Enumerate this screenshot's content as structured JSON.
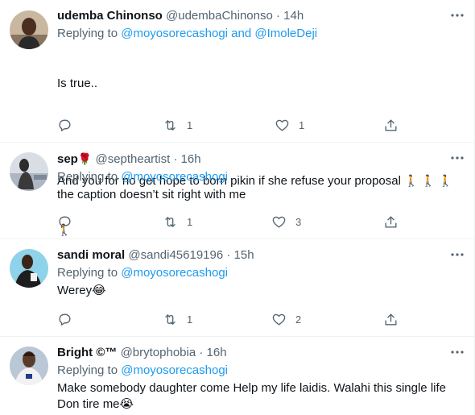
{
  "tweets": [
    {
      "name": "udemba Chinonso",
      "handle": "@udembaChinonso",
      "time": "14h",
      "replying_prefix": "Replying to",
      "replying_to": "@moyosorecashogi and @ImoleDeji",
      "text_line1": "Is true..",
      "text_line2": "And you for no get hope to born pikin if she refuse your proposal",
      "text_emoji": "🚶 🚶 🚶",
      "text_line3": "🚶",
      "replies": "",
      "retweets": "1",
      "likes": "1"
    },
    {
      "name": "sep",
      "name_emoji": "🌹",
      "handle": "@septheartist",
      "time": "16h",
      "replying_prefix": "Replying to",
      "replying_to": "@moyosorecashogi",
      "text": "the caption doesn’t sit right with me",
      "replies": "",
      "retweets": "1",
      "likes": "3"
    },
    {
      "name": "sandi moral",
      "handle": "@sandi45619196",
      "time": "15h",
      "replying_prefix": "Replying to",
      "replying_to": "@moyosorecashogi",
      "text": "Werey😂",
      "replies": "",
      "retweets": "1",
      "likes": "2"
    },
    {
      "name": "Bright ©™",
      "handle": "@brytophobia",
      "time": "16h",
      "replying_prefix": "Replying to",
      "replying_to": "@moyosorecashogi",
      "text": "Make somebody daughter come Help my  life laidis. Walahi this single life Don tire me😭"
    }
  ],
  "separator": "·",
  "icons": {
    "reply": "reply-icon",
    "retweet": "retweet-icon",
    "like": "heart-icon",
    "share": "share-icon",
    "more": "more-icon"
  },
  "colors": {
    "accent": "#1d9bf0",
    "secondary_text": "#536471",
    "border": "#eff3f4"
  }
}
